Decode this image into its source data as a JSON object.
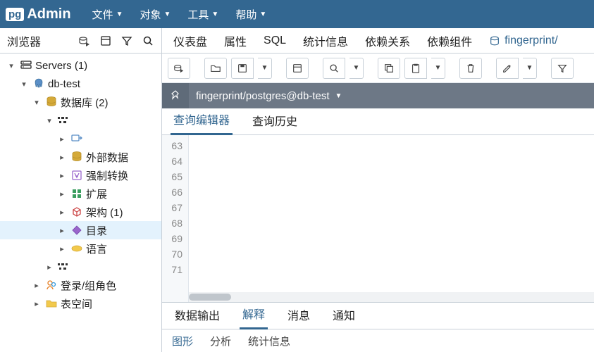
{
  "app": {
    "logo_pg": "pg",
    "logo_admin": "Admin"
  },
  "menubar": {
    "items": [
      "文件",
      "对象",
      "工具",
      "帮助"
    ]
  },
  "sidebar": {
    "title": "浏览器",
    "tree": [
      {
        "depth": 0,
        "tw": "v",
        "icon": "servers",
        "label": "Servers (1)"
      },
      {
        "depth": 1,
        "tw": "v",
        "icon": "server",
        "label": "db-test"
      },
      {
        "depth": 2,
        "tw": "v",
        "icon": "databases",
        "label": "数据库 (2)"
      },
      {
        "depth": 3,
        "tw": "v",
        "icon": "blur",
        "label": ""
      },
      {
        "depth": 4,
        "tw": ">",
        "icon": "cast",
        "label": ""
      },
      {
        "depth": 4,
        "tw": ">",
        "icon": "databases",
        "label": "外部数据"
      },
      {
        "depth": 4,
        "tw": ">",
        "icon": "fts",
        "label": "强制转换"
      },
      {
        "depth": 4,
        "tw": ">",
        "icon": "ext",
        "label": "扩展"
      },
      {
        "depth": 4,
        "tw": ">",
        "icon": "schema",
        "label": "架构 (1)"
      },
      {
        "depth": 4,
        "tw": ">",
        "icon": "catalog",
        "label": "目录",
        "sel": true
      },
      {
        "depth": 4,
        "tw": ">",
        "icon": "lang",
        "label": "语言"
      },
      {
        "depth": 3,
        "tw": ">",
        "icon": "blur",
        "label": ""
      },
      {
        "depth": 2,
        "tw": ">",
        "icon": "roles",
        "label": "登录/组角色"
      },
      {
        "depth": 2,
        "tw": ">",
        "icon": "tablespace",
        "label": "表空间"
      }
    ]
  },
  "tabs": {
    "items": [
      "仪表盘",
      "属性",
      "SQL",
      "统计信息",
      "依赖关系",
      "依赖组件"
    ],
    "active": "fingerprint/"
  },
  "connection": {
    "label": "fingerprint/postgres@db-test"
  },
  "query_tabs": {
    "items": [
      "查询编辑器",
      "查询历史"
    ],
    "active": 0
  },
  "editor": {
    "lines": [
      63,
      64,
      65,
      66,
      67,
      68,
      69,
      70,
      71
    ]
  },
  "output_tabs": {
    "items": [
      "数据输出",
      "解释",
      "消息",
      "通知"
    ],
    "active": 1
  },
  "output_sub": {
    "items": [
      "图形",
      "分析",
      "统计信息"
    ],
    "active": 0
  }
}
